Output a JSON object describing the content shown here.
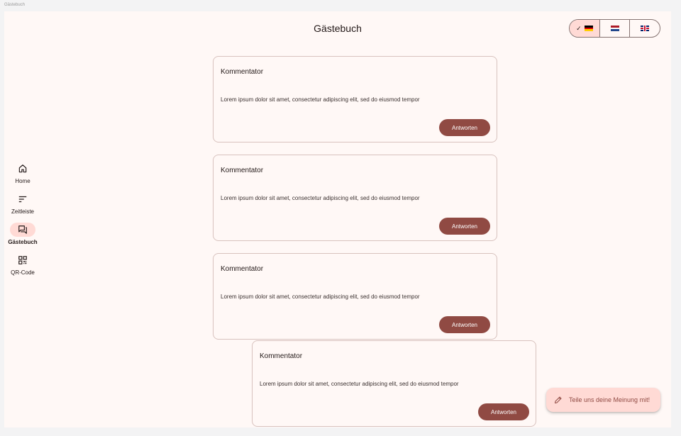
{
  "window": {
    "tab_title": "Gästebuch"
  },
  "header": {
    "title": "Gästebuch"
  },
  "language_selector": {
    "options": [
      {
        "flag": "de",
        "selected": true,
        "check_icon": "✓"
      },
      {
        "flag": "nl",
        "selected": false
      },
      {
        "flag": "gb",
        "selected": false
      }
    ]
  },
  "nav": {
    "items": [
      {
        "label": "Home",
        "icon": "home-icon",
        "active": false
      },
      {
        "label": "Zeitleiste",
        "icon": "sort-icon",
        "active": false
      },
      {
        "label": "Gästebuch",
        "icon": "forum-icon",
        "active": true
      },
      {
        "label": "QR-Code",
        "icon": "qr-code-icon",
        "active": false
      }
    ]
  },
  "entries": [
    {
      "author": "Kommentator",
      "text": "Lorem ipsum dolor sit amet, consectetur adipiscing elit, sed do eiusmod tempor",
      "reply_label": "Antworten"
    },
    {
      "author": "Kommentator",
      "text": "Lorem ipsum dolor sit amet, consectetur adipiscing elit, sed do eiusmod tempor",
      "reply_label": "Antworten"
    },
    {
      "author": "Kommentator",
      "text": "Lorem ipsum dolor sit amet, consectetur adipiscing elit, sed do eiusmod tempor",
      "reply_label": "Antworten"
    },
    {
      "author": "Kommentator",
      "text": "Lorem ipsum dolor sit amet, consectetur adipiscing elit, sed do eiusmod tempor",
      "reply_label": "Antworten"
    }
  ],
  "fab": {
    "label": "Teile uns deine Meinung mit!",
    "icon": "edit-icon"
  },
  "colors": {
    "background": "#fff8f6",
    "primary": "#904a43",
    "secondary_container": "#ffdad5",
    "outline": "#d8c2be"
  }
}
